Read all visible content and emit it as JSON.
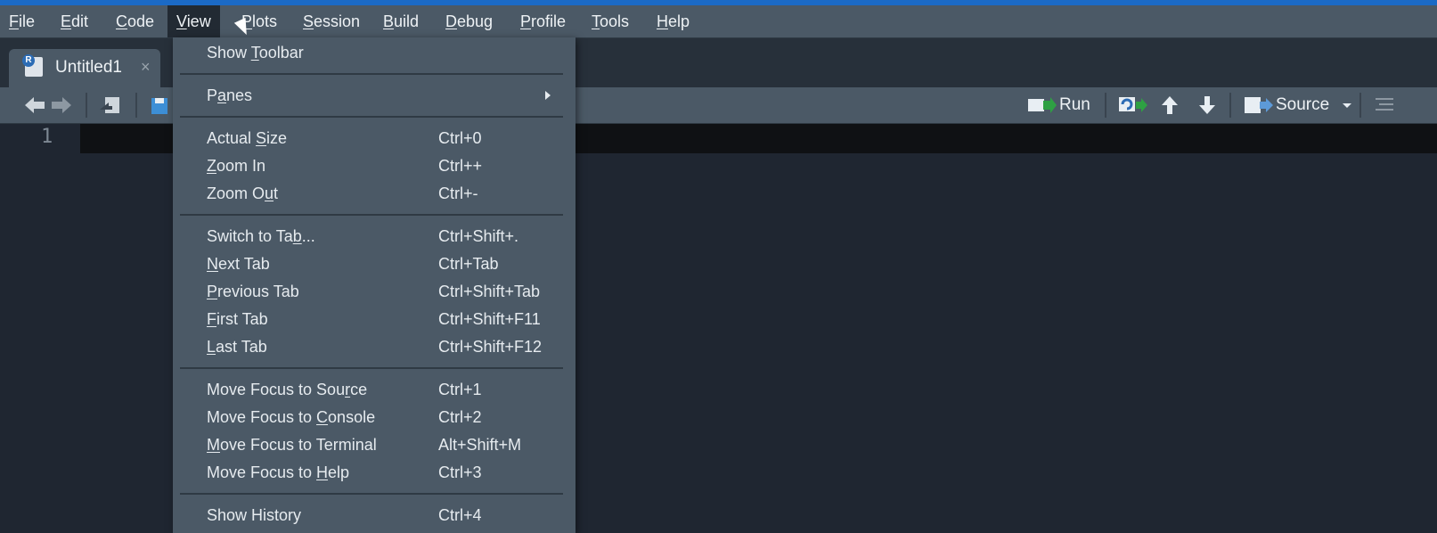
{
  "menubar": {
    "items": [
      {
        "label": "File",
        "u": "F",
        "rest": "ile"
      },
      {
        "label": "Edit",
        "u": "E",
        "rest": "dit"
      },
      {
        "label": "Code",
        "u": "C",
        "rest": "ode"
      },
      {
        "label": "View",
        "u": "V",
        "rest": "iew"
      },
      {
        "label": "Plots",
        "u": "P",
        "rest": "lots"
      },
      {
        "label": "Session",
        "u": "S",
        "rest": "ession"
      },
      {
        "label": "Build",
        "u": "B",
        "rest": "uild"
      },
      {
        "label": "Debug",
        "u": "D",
        "rest": "ebug"
      },
      {
        "label": "Profile",
        "u": "P",
        "rest": "rofile"
      },
      {
        "label": "Tools",
        "u": "T",
        "rest": "ools"
      },
      {
        "label": "Help",
        "u": "H",
        "rest": "elp"
      }
    ],
    "active": "View"
  },
  "tab": {
    "title": "Untitled1",
    "close": "×",
    "r_letter": "R"
  },
  "toolbar": {
    "run_label": "Run",
    "source_label": "Source"
  },
  "editor": {
    "line_number": "1"
  },
  "view_menu": {
    "items": [
      {
        "type": "item",
        "pre": "Show ",
        "u": "T",
        "post": "oolbar",
        "shortcut": ""
      },
      {
        "type": "sep"
      },
      {
        "type": "item",
        "pre": "P",
        "u": "a",
        "post": "nes",
        "shortcut": "",
        "submenu": true
      },
      {
        "type": "sep"
      },
      {
        "type": "item",
        "pre": "Actual ",
        "u": "S",
        "post": "ize",
        "shortcut": "Ctrl+0"
      },
      {
        "type": "item",
        "pre": "",
        "u": "Z",
        "post": "oom In",
        "shortcut": "Ctrl++"
      },
      {
        "type": "item",
        "pre": "Zoom O",
        "u": "u",
        "post": "t",
        "shortcut": "Ctrl+-"
      },
      {
        "type": "sep"
      },
      {
        "type": "item",
        "pre": "Switch to Ta",
        "u": "b",
        "post": "...",
        "shortcut": "Ctrl+Shift+."
      },
      {
        "type": "item",
        "pre": "",
        "u": "N",
        "post": "ext Tab",
        "shortcut": "Ctrl+Tab"
      },
      {
        "type": "item",
        "pre": "",
        "u": "P",
        "post": "revious Tab",
        "shortcut": "Ctrl+Shift+Tab"
      },
      {
        "type": "item",
        "pre": "",
        "u": "F",
        "post": "irst Tab",
        "shortcut": "Ctrl+Shift+F11"
      },
      {
        "type": "item",
        "pre": "",
        "u": "L",
        "post": "ast Tab",
        "shortcut": "Ctrl+Shift+F12"
      },
      {
        "type": "sep"
      },
      {
        "type": "item",
        "pre": "Move Focus to Sou",
        "u": "r",
        "post": "ce",
        "shortcut": "Ctrl+1"
      },
      {
        "type": "item",
        "pre": "Move Focus to ",
        "u": "C",
        "post": "onsole",
        "shortcut": "Ctrl+2"
      },
      {
        "type": "item",
        "pre": "",
        "u": "M",
        "post": "ove Focus to Terminal",
        "shortcut": "Alt+Shift+M"
      },
      {
        "type": "item",
        "pre": "Move Focus to ",
        "u": "H",
        "post": "elp",
        "shortcut": "Ctrl+3"
      },
      {
        "type": "sep"
      },
      {
        "type": "item",
        "pre": "Show History",
        "u": "",
        "post": "",
        "shortcut": "Ctrl+4"
      }
    ]
  },
  "colors": {
    "accent": "#1b6ac6",
    "menu_bg": "#4b5966",
    "editor_bg": "#1f2631"
  }
}
